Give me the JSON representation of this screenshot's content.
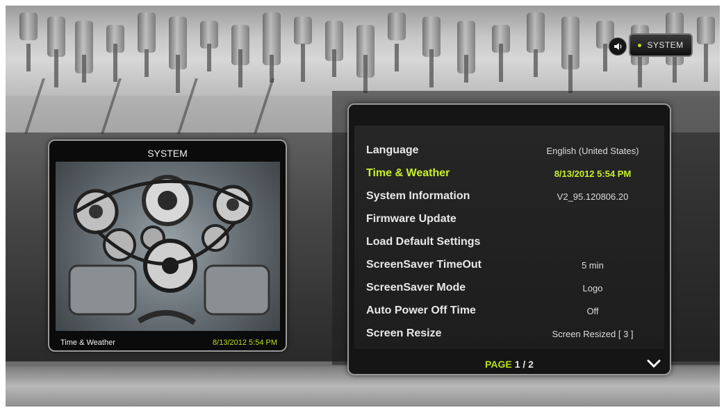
{
  "header": {
    "audio_icon": "speaker-icon",
    "section_label": "SYSTEM",
    "accent": "#b8e01c"
  },
  "preview": {
    "title": "SYSTEM",
    "image": "engine-photo",
    "footer_label": "Time & Weather",
    "footer_value": "8/13/2012 5:54 PM"
  },
  "menu": {
    "items": [
      {
        "label": "Language",
        "value": "English (United States)",
        "selected": false
      },
      {
        "label": "Time & Weather",
        "value": "8/13/2012 5:54 PM",
        "selected": true
      },
      {
        "label": "System Information",
        "value": "V2_95.120806.20",
        "selected": false
      },
      {
        "label": "Firmware Update",
        "value": "",
        "selected": false
      },
      {
        "label": "Load Default Settings",
        "value": "",
        "selected": false
      },
      {
        "label": "ScreenSaver TimeOut",
        "value": "5 min",
        "selected": false
      },
      {
        "label": "ScreenSaver Mode",
        "value": "Logo",
        "selected": false
      },
      {
        "label": "Auto Power Off Time",
        "value": "Off",
        "selected": false
      },
      {
        "label": "Screen Resize",
        "value": "Screen Resized [ 3 ]",
        "selected": false
      }
    ],
    "page_word": "PAGE",
    "page_number": "1 / 2",
    "next_icon": "chevron-down-icon"
  }
}
